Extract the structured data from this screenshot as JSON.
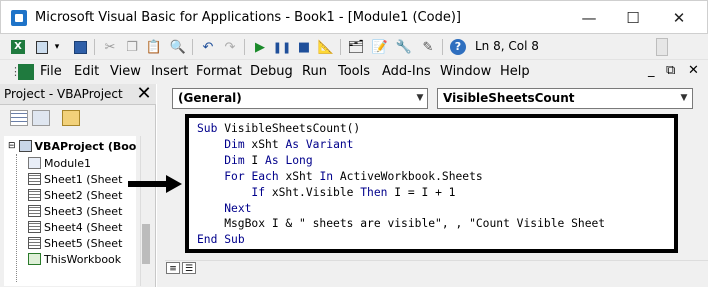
{
  "window": {
    "title": "Microsoft Visual Basic for Applications - Book1 - [Module1 (Code)]",
    "minimize_glyph": "—",
    "maximize_glyph": "☐",
    "close_glyph": "✕"
  },
  "toolbar": {
    "cursor_position": "Ln 8, Col 8",
    "icons": [
      "excel-icon",
      "insert-module-icon",
      "save-icon",
      "cut-icon",
      "copy-icon",
      "paste-icon",
      "find-icon",
      "undo-icon",
      "redo-icon",
      "run-icon",
      "break-icon",
      "reset-icon",
      "design-mode-icon",
      "project-explorer-icon",
      "properties-icon",
      "object-browser-icon",
      "toolbox-icon",
      "help-icon"
    ]
  },
  "menu": {
    "items": [
      "File",
      "Edit",
      "View",
      "Insert",
      "Format",
      "Debug",
      "Run",
      "Tools",
      "Add-Ins",
      "Window",
      "Help"
    ],
    "mdi_minimize": "_",
    "mdi_restore": "⧉",
    "mdi_close": "✕"
  },
  "project_pane": {
    "title": "Project - VBAProject",
    "close_glyph": "✕",
    "tree": {
      "root": "VBAProject (Boo",
      "items": [
        "Module1",
        "Sheet1 (Sheet",
        "Sheet2 (Sheet",
        "Sheet3 (Sheet",
        "Sheet4 (Sheet",
        "Sheet5 (Sheet",
        "ThisWorkbook"
      ]
    }
  },
  "code_window": {
    "object_combo": "(General)",
    "procedure_combo": "VisibleSheetsCount",
    "lines": [
      "Sub VisibleSheetsCount()",
      "    Dim xSht As Variant",
      "    Dim I As Long",
      "    For Each xSht In ActiveWorkbook.Sheets",
      "        If xSht.Visible Then I = I + 1",
      "    Next",
      "    MsgBox I & \" sheets are visible\", , \"Count Visible Sheet",
      "End Sub"
    ]
  },
  "colors": {
    "keyword": "#00008b",
    "highlight_border": "#000000"
  }
}
